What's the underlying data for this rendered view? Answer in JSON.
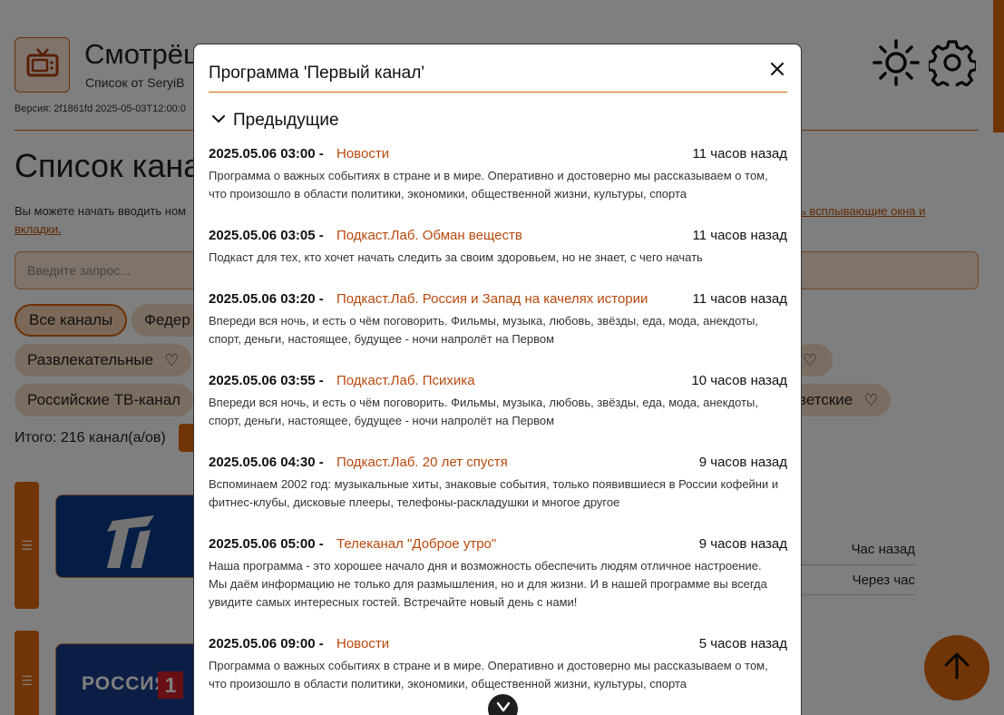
{
  "app": {
    "title": "Смотрёш",
    "subtitle": "Список от SeryiB",
    "version": "Версия: 2f1861fd 2025-05-03T12:00:0"
  },
  "page": {
    "heading": "Список кана",
    "intro_text": "Вы можете начать вводить ном",
    "intro_link_left": "вкладки",
    "intro_link_after": ".",
    "intro_link_right": "ь всплывающие окна и",
    "search_placeholder": "Введите запрос...",
    "chips": [
      {
        "label": "Все каналы"
      },
      {
        "label": "Федер"
      },
      {
        "label": "Развлекательные"
      },
      {
        "label": "Российские ТВ-канал"
      },
      {
        "label": "ветские"
      }
    ],
    "total": "Итого: 216 канал(а/ов)",
    "channel_logo_text": "РОССИЯ",
    "channel_logo_num": "1",
    "relative_times": [
      "Час назад",
      "Через час"
    ]
  },
  "modal": {
    "title": "Программа 'Первый канал'",
    "section_label": "Предыдущие",
    "programs": [
      {
        "time": "2025.05.06 03:00 -",
        "name": "Новости",
        "ago": "11 часов назад",
        "desc": "Программа о важных событиях в стране и в мире. Оперативно и достоверно мы рассказываем о том, что произошло в области политики, экономики, общественной жизни, культуры, спорта"
      },
      {
        "time": "2025.05.06 03:05 -",
        "name": "Подкаст.Лаб. Обман веществ",
        "ago": "11 часов назад",
        "desc": "Подкаст для тех, кто хочет начать следить за своим здоровьем, но не знает, с чего начать"
      },
      {
        "time": "2025.05.06 03:20 -",
        "name": "Подкаст.Лаб. Россия и Запад на качелях истории",
        "ago": "11 часов назад",
        "desc": "Впереди вся ночь, и есть о чём поговорить. Фильмы, музыка, любовь, звёзды, еда, мода, анекдоты, спорт, деньги, настоящее, будущее - ночи напролёт на Первом"
      },
      {
        "time": "2025.05.06 03:55 -",
        "name": "Подкаст.Лаб. Психика",
        "ago": "10 часов назад",
        "desc": "Впереди вся ночь, и есть о чём поговорить. Фильмы, музыка, любовь, звёзды, еда, мода, анекдоты, спорт, деньги, настоящее, будущее - ночи напролёт на Первом"
      },
      {
        "time": "2025.05.06 04:30 -",
        "name": "Подкаст.Лаб. 20 лет спустя",
        "ago": "9 часов назад",
        "desc": "Вспоминаем 2002 год: музыкальные хиты, знаковые события, только появившиеся в России кофейни и фитнес-клубы, дисковые плееры, телефоны-раскладушки и многое другое"
      },
      {
        "time": "2025.05.06 05:00 -",
        "name": "Телеканал \"Доброе утро\"",
        "ago": "9 часов назад",
        "desc": "Наша программа - это хорошее начало дня и возможность обеспечить людям отличное настроение. Мы даём информацию не только для размышления, но и для жизни. И в нашей программе вы всегда увидите самых интересных гостей. Встречайте новый день с нами!"
      },
      {
        "time": "2025.05.06 09:00 -",
        "name": "Новости",
        "ago": "5 часов назад",
        "desc": "Программа о важных событиях в стране и в мире. Оперативно и достоверно мы рассказываем о том, что произошло в области политики, экономики, общественной жизни, культуры, спорта"
      }
    ]
  },
  "colors": {
    "accent": "#e2690d",
    "link": "#b8480c",
    "overlay": "rgba(0,0,0,0.5)"
  },
  "icons": [
    "tv-icon",
    "sun-icon",
    "gear-icon",
    "close-icon",
    "chevron-down-icon",
    "list-icon",
    "heart-icon",
    "arrow-up-icon"
  ]
}
